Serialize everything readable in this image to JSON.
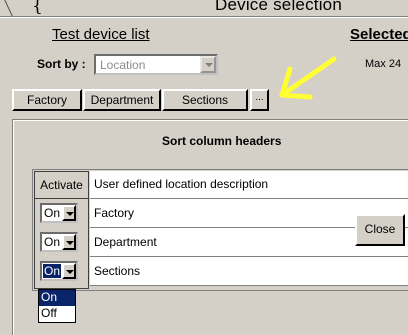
{
  "window": {
    "title": "Device selection"
  },
  "left": {
    "title": "Test device list",
    "sort_label": "Sort by :",
    "sort_value": "Location"
  },
  "right": {
    "title": "Selected",
    "max_label": "Max 24"
  },
  "header_buttons": [
    "Factory",
    "Department",
    "Sections",
    "..."
  ],
  "dialog": {
    "title": "Sort column headers",
    "col_activate": "Activate",
    "col_description": "User defined location description",
    "rows": [
      {
        "activate": "On",
        "label": "Factory"
      },
      {
        "activate": "On",
        "label": "Department"
      },
      {
        "activate": "On",
        "label": "Sections"
      }
    ],
    "dropdown_options": [
      "On",
      "Off"
    ],
    "close_label": "Close"
  },
  "colors": {
    "arrow": "#ffff33",
    "highlight": "#0a246a",
    "panel_bg": "#d4d0c8"
  }
}
